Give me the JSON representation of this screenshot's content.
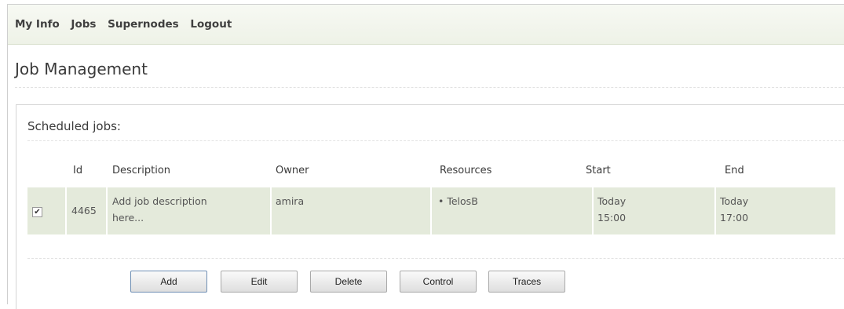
{
  "nav": {
    "items": [
      "My Info",
      "Jobs",
      "Supernodes",
      "Logout"
    ]
  },
  "page": {
    "title": "Job Management"
  },
  "scheduled": {
    "title": "Scheduled jobs:",
    "columns": [
      "Id",
      "Description",
      "Owner",
      "Resources",
      "Start",
      "End"
    ],
    "row": {
      "checked": true,
      "id": "4465",
      "description_line1": "Add job description",
      "description_line2": "here...",
      "owner": "amira",
      "resource": "TelosB",
      "start_day": "Today",
      "start_time": "15:00",
      "end_day": "Today",
      "end_time": "17:00"
    }
  },
  "buttons": {
    "add": "Add",
    "edit": "Edit",
    "delete": "Delete",
    "control": "Control",
    "traces": "Traces"
  }
}
